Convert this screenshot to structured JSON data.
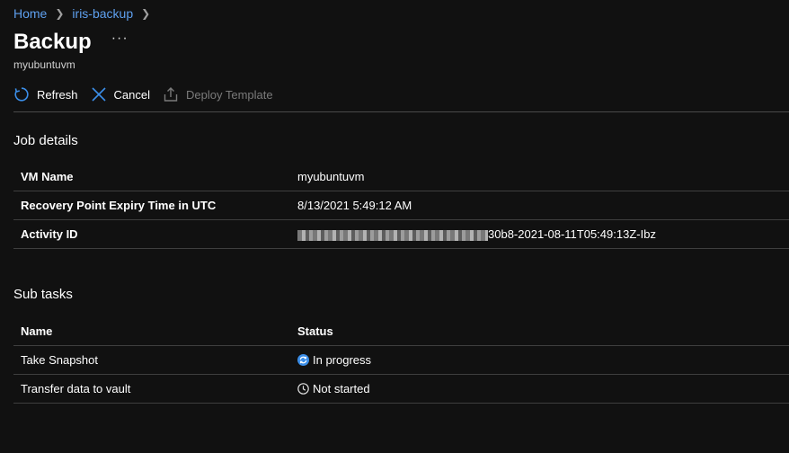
{
  "breadcrumb": {
    "home": "Home",
    "vault": "iris-backup"
  },
  "header": {
    "title": "Backup",
    "subtitle": "myubuntuvm",
    "more": "···"
  },
  "toolbar": {
    "refresh": "Refresh",
    "cancel": "Cancel",
    "deploy": "Deploy Template"
  },
  "job_details": {
    "heading": "Job details",
    "rows": [
      {
        "key": "VM Name",
        "value": "myubuntuvm"
      },
      {
        "key": "Recovery Point Expiry Time in UTC",
        "value": "8/13/2021 5:49:12 AM"
      },
      {
        "key": "Activity ID",
        "value": "30b8-2021-08-11T05:49:13Z-Ibz"
      }
    ]
  },
  "sub_tasks": {
    "heading": "Sub tasks",
    "columns": {
      "name": "Name",
      "status": "Status"
    },
    "rows": [
      {
        "name": "Take Snapshot",
        "status": "In progress",
        "status_icon": "sync-icon"
      },
      {
        "name": "Transfer data to vault",
        "status": "Not started",
        "status_icon": "clock-icon"
      }
    ]
  },
  "colors": {
    "background": "#111111",
    "link": "#5ea0ef",
    "accent": "#3b8ee8"
  }
}
